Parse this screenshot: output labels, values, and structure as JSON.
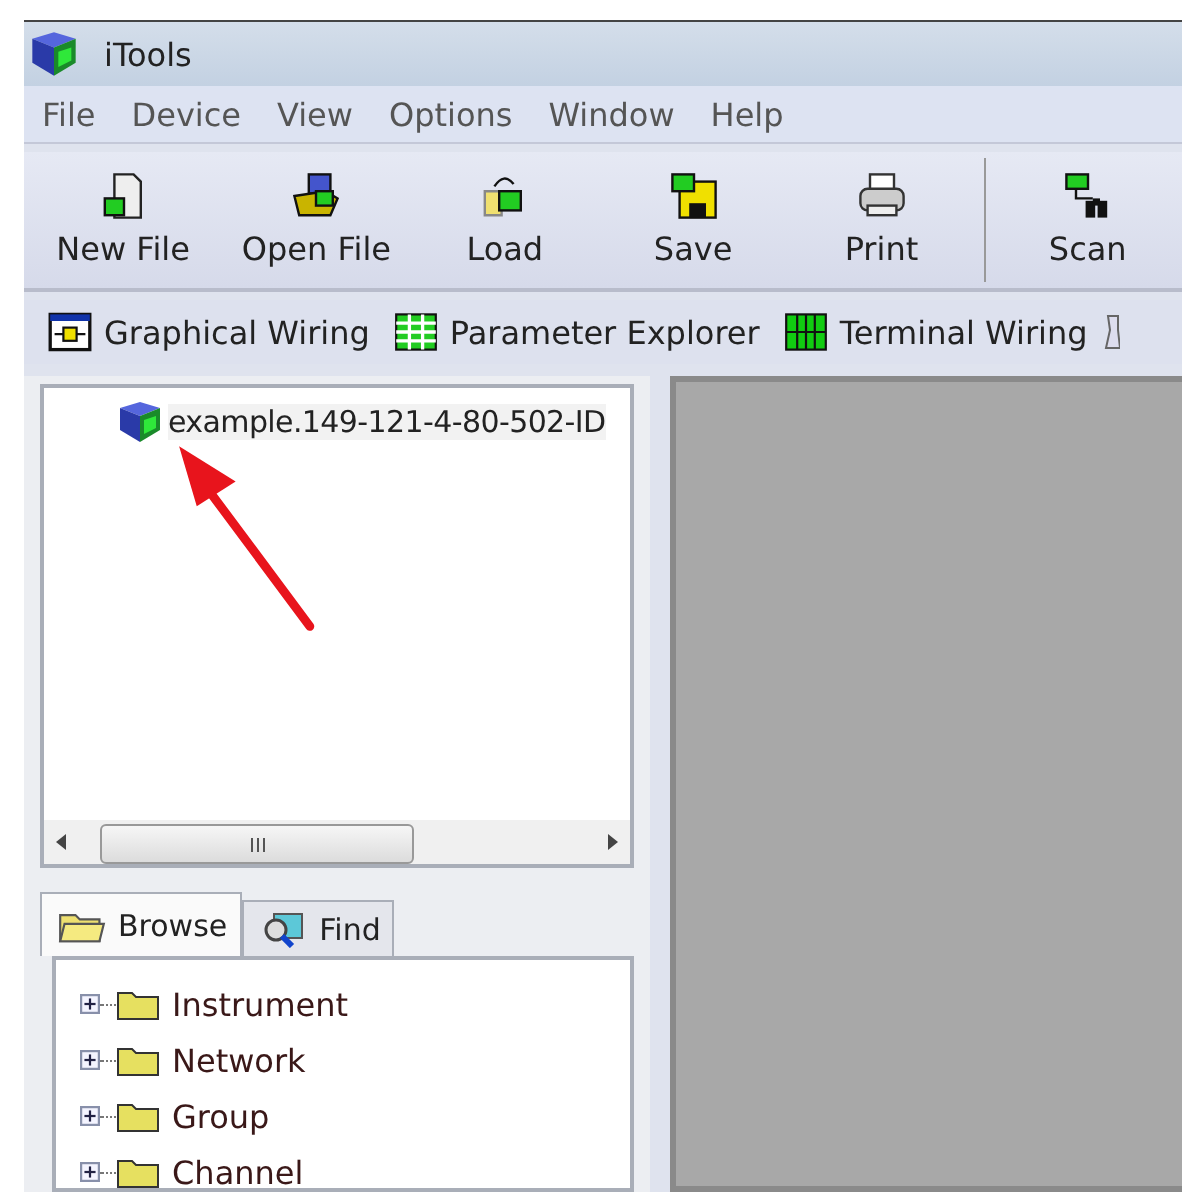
{
  "window": {
    "title": "iTools"
  },
  "menu": [
    "File",
    "Device",
    "View",
    "Options",
    "Window",
    "Help"
  ],
  "toolbar": [
    {
      "label": "New File",
      "kind": "newfile"
    },
    {
      "label": "Open File",
      "kind": "open"
    },
    {
      "label": "Load",
      "kind": "load"
    },
    {
      "label": "Save",
      "kind": "save"
    },
    {
      "label": "Print",
      "kind": "print"
    },
    {
      "label": "Scan",
      "kind": "scan"
    }
  ],
  "view_bar": [
    {
      "label": "Graphical Wiring",
      "kind": "wiring"
    },
    {
      "label": "Parameter Explorer",
      "kind": "grid"
    },
    {
      "label": "Terminal Wiring",
      "kind": "terminal"
    }
  ],
  "device_tree": {
    "items": [
      {
        "label": "example.149-121-4-80-502-ID"
      }
    ]
  },
  "tabs": [
    {
      "label": "Browse",
      "kind": "folder",
      "selected": true
    },
    {
      "label": "Find",
      "kind": "find",
      "selected": false
    }
  ],
  "browse_tree": [
    {
      "label": "Instrument",
      "expanded": false
    },
    {
      "label": "Network",
      "expanded": false
    },
    {
      "label": "Group",
      "expanded": false
    },
    {
      "label": "Channel",
      "expanded": false
    }
  ]
}
